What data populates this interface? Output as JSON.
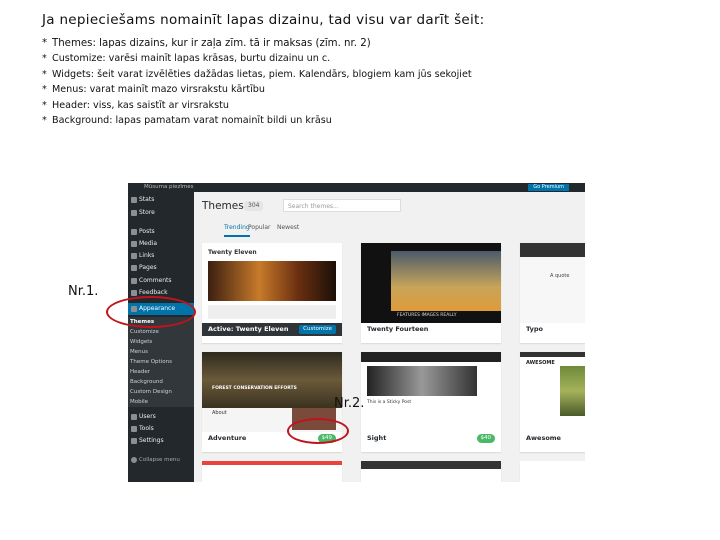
{
  "slide": {
    "title": "Ja nepieciešams nomainīt lapas dizainu, tad visu var darīt šeit:",
    "bullets": [
      "Themes: lapas dizains, kur ir zaļa zīm. tā ir maksas (zīm. nr. 2)",
      "Customize: varēsi mainīt lapas krāsas, burtu dizainu un c.",
      "Widgets: šeit varat izvēlēties dažādas lietas, piem.  Kalendārs, blogiem kam jūs sekojiet",
      "Menus: varat mainīt mazo virsrakstu kārtību",
      "Header: viss, kas saistīt ar virsrakstu",
      "Background: lapas pamatam varat nomainīt bildi un krāsu"
    ],
    "bullet_marker": "*",
    "label_nr1": "Nr.1.",
    "label_nr2": "Nr.2."
  },
  "wp": {
    "topbar": {
      "site": "Mūsuma piezīmes",
      "premium": "Go Premium"
    },
    "sidebar": {
      "items": [
        "Stats",
        "Store",
        "Posts",
        "Media",
        "Links",
        "Pages",
        "Comments",
        "Feedback",
        "Appearance"
      ],
      "subitems": [
        "Themes",
        "Customize",
        "Widgets",
        "Menus",
        "Theme Options",
        "Header",
        "Background",
        "Custom Design",
        "Mobile"
      ],
      "lower": [
        "Users",
        "Tools",
        "Settings"
      ],
      "collapse": "Collapse menu"
    },
    "header": {
      "title": "Themes",
      "count": "304",
      "search_placeholder": "Search themes..."
    },
    "tabs": [
      "Trending",
      "Popular",
      "Newest"
    ],
    "themes": [
      {
        "name": "Twenty Eleven",
        "active_prefix": "Active:",
        "button": "Customize"
      },
      {
        "name": "Twenty Fourteen"
      },
      {
        "name": "Typo"
      },
      {
        "name": "Adventure",
        "price": "$49"
      },
      {
        "name": "Sight",
        "price": "$40"
      },
      {
        "name": "Awesome"
      }
    ],
    "card_texts": {
      "eleven_header": "Twenty Eleven",
      "adventure_header": "FOREST CONSERVATION EFFORTS",
      "adventure_about": "About",
      "sight_post": "This is a Sticky Post",
      "awesome_header": "AWESOME",
      "typo_header": "A quote",
      "fourteen_caption": "FEATURES IMAGES REALLY"
    }
  },
  "colors": {
    "annotation": "#c0141c",
    "wp_blue": "#0073aa",
    "wp_dark": "#23282d",
    "price_green": "#4ab866"
  }
}
